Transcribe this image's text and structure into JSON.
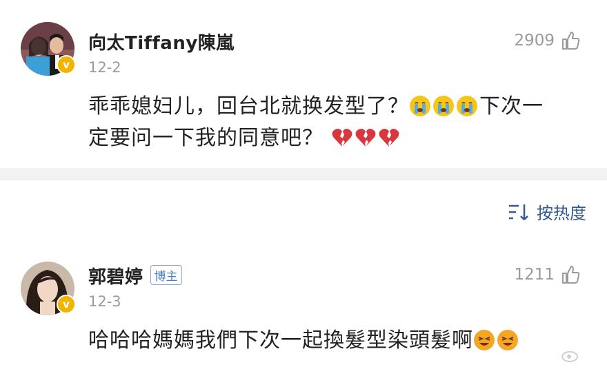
{
  "comments": [
    {
      "username": "向太Tiffany陳嵐",
      "date": "12-2",
      "likes": "2909",
      "text_line1": "乖乖媳妇儿，回台北就换发型了？",
      "text_line1b": "下次一",
      "text_line2": "定要问一下我的同意吧？",
      "emoji_a": "crying-face-icon",
      "emoji_b": "broken-heart-icon"
    },
    {
      "username": "郭碧婷",
      "badge": "博主",
      "date": "12-3",
      "likes": "1211",
      "text": "哈哈哈媽媽我們下次一起換髮型染頭髮啊",
      "emoji": "laughing-face-icon"
    }
  ],
  "sort": {
    "label": "按热度",
    "icon": "sort-lines-icon"
  },
  "colors": {
    "accent": "#335a92",
    "verified": "#f3b400",
    "broken_heart": "#d9363e"
  }
}
